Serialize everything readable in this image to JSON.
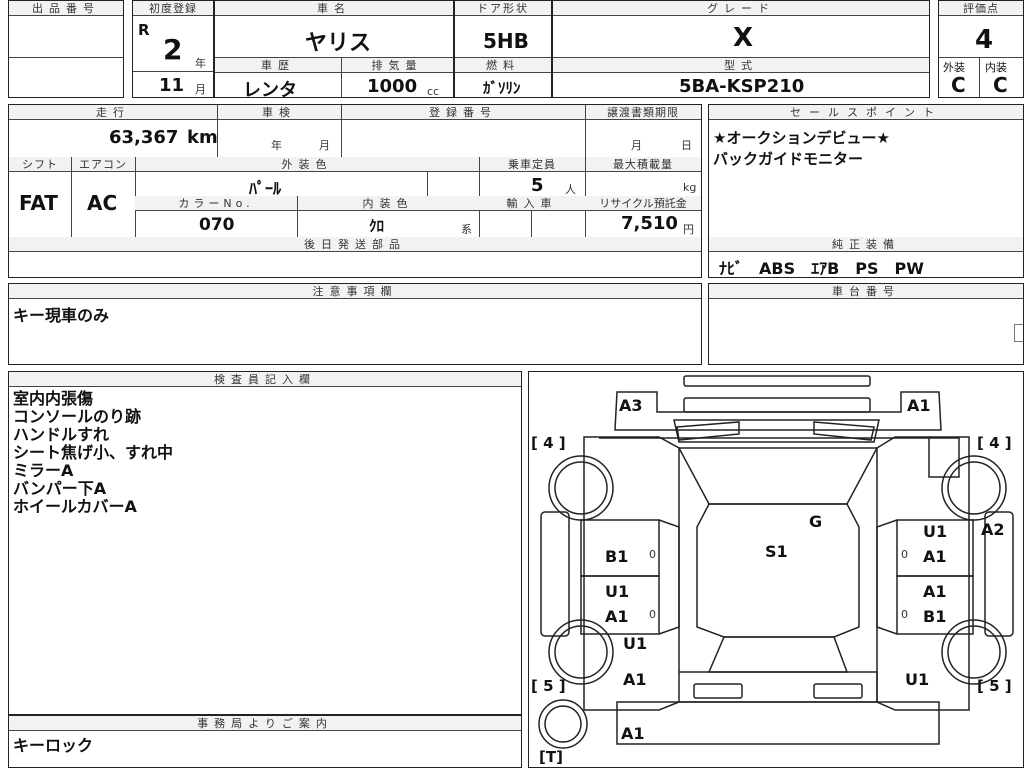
{
  "headers": {
    "lot_no": "出品番号",
    "first_reg": "初度登録",
    "car_name": "車名",
    "door_type": "ドア形状",
    "grade": "グレード",
    "score": "評価点",
    "history": "車歴",
    "displacement": "排気量",
    "fuel": "燃料",
    "model_code": "型式",
    "exterior_score": "外装",
    "interior_score": "内装",
    "mileage": "走行",
    "inspection": "車検",
    "reg_no": "登録番号",
    "transfer_deadline": "譲渡書類期限",
    "sales_points": "セールスポイント",
    "shift": "シフト",
    "aircon": "エアコン",
    "ext_color": "外装色",
    "capacity": "乗車定員",
    "max_load": "最大積載量",
    "color_no": "カラーNo.",
    "int_color": "内装色",
    "import": "輸入車",
    "recycle_fee": "リサイクル預託金",
    "later_parts": "後日発送部品",
    "genuine_equipment": "純正装備",
    "notes": "注意事項欄",
    "chassis_no": "車台番号",
    "inspector_notes": "検査員記入欄",
    "office_notes": "事務局よりご案内"
  },
  "vehicle": {
    "era": "R",
    "year": "2",
    "year_unit": "年",
    "month": "11",
    "month_unit": "月",
    "car_name": "ヤリス",
    "door_type": "5HB",
    "grade": "X",
    "score": "4",
    "history": "レンタ",
    "displacement": "1000",
    "displacement_unit": "cc",
    "fuel": "ｶﾞｿﾘﾝ",
    "model_code": "5BA-KSP210",
    "exterior_score": "C",
    "interior_score": "C",
    "mileage": "63,367",
    "mileage_unit": "km",
    "inspection_year_unit": "年",
    "inspection_month_unit": "月",
    "transfer_month_unit": "月",
    "transfer_day_unit": "日",
    "shift": "FAT",
    "aircon": "AC",
    "ext_color": "ﾊﾟｰﾙ",
    "capacity": "5",
    "capacity_unit": "人",
    "max_load_unit": "kg",
    "color_no": "070",
    "int_color": "ｸﾛ",
    "int_color_unit": "系",
    "recycle_fee": "7,510",
    "recycle_unit": "円"
  },
  "sales_points": [
    "★オークションデビュー★",
    "バックガイドモニター"
  ],
  "genuine_equipment": "ﾅﾋﾞ　ABS　ｴｱB　PS　PW",
  "notes": "キー現車のみ",
  "inspector_notes": [
    "室内内張傷",
    "コンソールのり跡",
    "ハンドルすれ",
    "シート焦げ小、すれ中",
    "ミラーA",
    "バンパー下A",
    "ホイールカバーA"
  ],
  "office_notes": "キーロック",
  "diagram": {
    "tire_front_left": "[ 4 ]",
    "tire_front_right": "[ 4 ]",
    "tire_rear_left": "[ 5 ]",
    "tire_rear_right": "[ 5 ]",
    "spare": "[T]",
    "marks": {
      "front_bumper_left": "A3",
      "front_bumper_right": "A1",
      "windshield": "G",
      "roof": "S1",
      "right_fender": "A2",
      "right_front_door_upper": "U1",
      "right_front_door_lower": "A1",
      "right_rear_door_upper": "A1",
      "right_rear_door_lower": "B1",
      "left_front_door": "B1",
      "left_rear_door_upper": "U1",
      "left_rear_door_lower": "A1",
      "left_rear_fender_upper": "U1",
      "left_rear_fender_lower": "A1",
      "right_rear_fender": "U1",
      "rear_bumper": "A1",
      "side_mirror_small": "0"
    }
  }
}
